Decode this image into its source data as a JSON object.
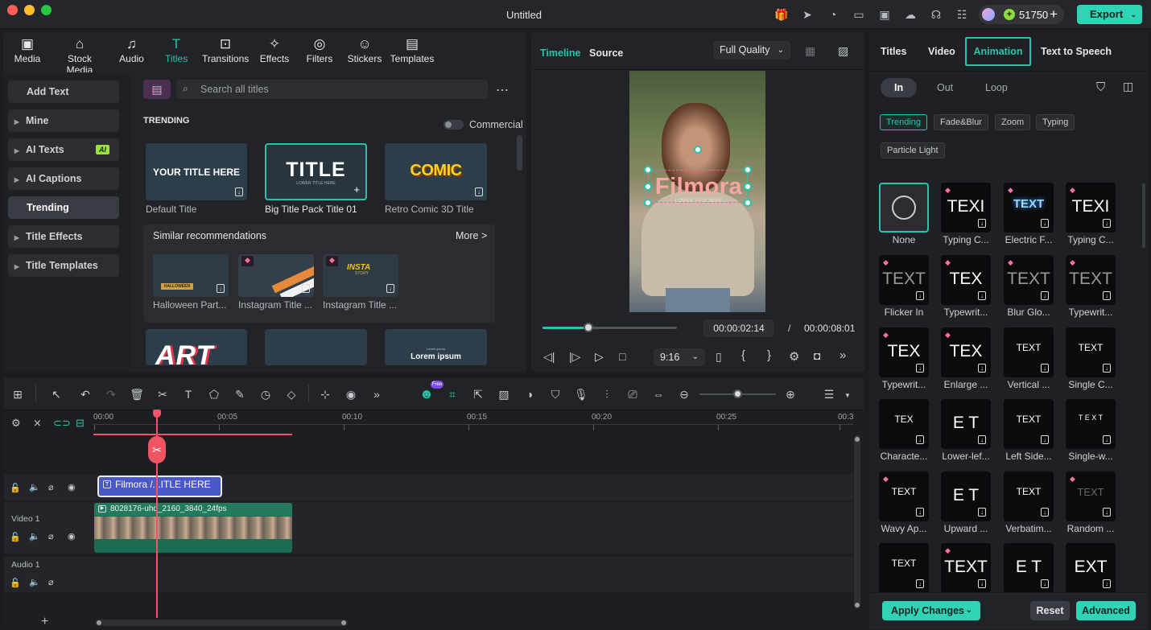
{
  "window": {
    "title": "Untitled",
    "credits": "51750",
    "export_label": "Export"
  },
  "media_tabs": [
    {
      "label": "Media",
      "icon": "media-icon"
    },
    {
      "label": "Stock Media",
      "icon": "stock-media-icon"
    },
    {
      "label": "Audio",
      "icon": "audio-icon"
    },
    {
      "label": "Titles",
      "icon": "titles-icon",
      "active": true
    },
    {
      "label": "Transitions",
      "icon": "transitions-icon"
    },
    {
      "label": "Effects",
      "icon": "effects-icon"
    },
    {
      "label": "Filters",
      "icon": "filters-icon"
    },
    {
      "label": "Stickers",
      "icon": "stickers-icon"
    },
    {
      "label": "Templates",
      "icon": "templates-icon"
    }
  ],
  "sidebar": {
    "items": [
      {
        "label": "Add Text"
      },
      {
        "label": "Mine"
      },
      {
        "label": "AI Texts",
        "badge": "AI"
      },
      {
        "label": "AI Captions"
      },
      {
        "label": "Trending"
      },
      {
        "label": "Title Effects"
      },
      {
        "label": "Title Templates"
      }
    ]
  },
  "library": {
    "search_placeholder": "Search all titles",
    "section": "TRENDING",
    "commercial_label": "Commercial",
    "titles": [
      {
        "name": "Default Title",
        "text": "YOUR TITLE HERE"
      },
      {
        "name": "Big Title Pack Title 01",
        "text": "TITLE",
        "sub": "LOWER TITLE HERE"
      },
      {
        "name": "Retro Comic 3D Title",
        "text": "COMIC"
      }
    ],
    "similar_label": "Similar recommendations",
    "more_label": "More >",
    "similar": [
      {
        "name": "Halloween Part...",
        "text": "HALLOWEEN"
      },
      {
        "name": "Instagram Title ..."
      },
      {
        "name": "Instagram Title ...",
        "text": "INSTA",
        "sub": "STORY"
      }
    ],
    "bottom_row": [
      {
        "text": "ART"
      },
      {
        "text": ""
      },
      {
        "text": "Lorem ipsum",
        "sub": "Lorem ipsum"
      }
    ]
  },
  "preview": {
    "tab_timeline": "Timeline",
    "tab_source": "Source",
    "quality": "Full Quality",
    "overlay_title": "Filmora",
    "overlay_sub": "LOWER TITLE HERE",
    "current_time": "00:00:02:14",
    "separator": "/",
    "total_time": "00:00:08:01",
    "aspect": "9:16",
    "progress": 0.34
  },
  "inspector": {
    "tabs": [
      "Titles",
      "Video",
      "Animation",
      "Text to Speech"
    ],
    "subtabs": [
      "In",
      "Out",
      "Loop"
    ],
    "chips": [
      "Trending",
      "Fade&Blur",
      "Zoom",
      "Typing",
      "Particle Light"
    ],
    "animations": [
      {
        "name": "None",
        "text": ""
      },
      {
        "name": "Typing C...",
        "text": "TEXI",
        "premium": true
      },
      {
        "name": "Electric F...",
        "text": "TEXT",
        "premium": true
      },
      {
        "name": "Typing C...",
        "text": "TEXI",
        "premium": true
      },
      {
        "name": "Flicker In",
        "text": "TEXT",
        "premium": true
      },
      {
        "name": "Typewrit...",
        "text": "TEX",
        "premium": true
      },
      {
        "name": "Blur Glo...",
        "text": "TEXT",
        "premium": true
      },
      {
        "name": "Typewrit...",
        "text": "TEXT",
        "premium": true
      },
      {
        "name": "Typewrit...",
        "text": "TEX",
        "premium": true
      },
      {
        "name": "Enlarge ...",
        "text": "TEX",
        "premium": true
      },
      {
        "name": "Vertical ...",
        "text": "TEXT"
      },
      {
        "name": "Single C...",
        "text": "TEXT"
      },
      {
        "name": "Characte...",
        "text": "TEX"
      },
      {
        "name": "Lower-lef...",
        "text": "E T"
      },
      {
        "name": "Left Side...",
        "text": "TEXT"
      },
      {
        "name": "Single-w...",
        "text": "T E X T"
      },
      {
        "name": "Wavy Ap...",
        "text": "TEXT",
        "premium": true
      },
      {
        "name": "Upward ...",
        "text": "E T"
      },
      {
        "name": "Verbatim...",
        "text": "TEXT"
      },
      {
        "name": "Random ...",
        "text": "TEXT",
        "premium": true
      },
      {
        "name": "",
        "text": "TEXT"
      },
      {
        "name": "",
        "text": "TEXT",
        "premium": true
      },
      {
        "name": "",
        "text": "E T"
      },
      {
        "name": "",
        "text": "EXT"
      }
    ],
    "apply_label": "Apply Changes",
    "reset_label": "Reset",
    "advanced_label": "Advanced"
  },
  "timeline": {
    "ruler": [
      "00:00",
      "00:05",
      "00:10",
      "00:15",
      "00:20",
      "00:25",
      "00:3"
    ],
    "title_clip": "Filmora /...ITLE HERE",
    "video_clip": "8028176-uhd_2160_3840_24fps",
    "video_track": "Video 1",
    "audio_track": "Audio 1",
    "badge": "Free"
  },
  "colors": {
    "accent": "#27c4a9",
    "export": "#2fd4b4",
    "playhead": "#f05563"
  }
}
